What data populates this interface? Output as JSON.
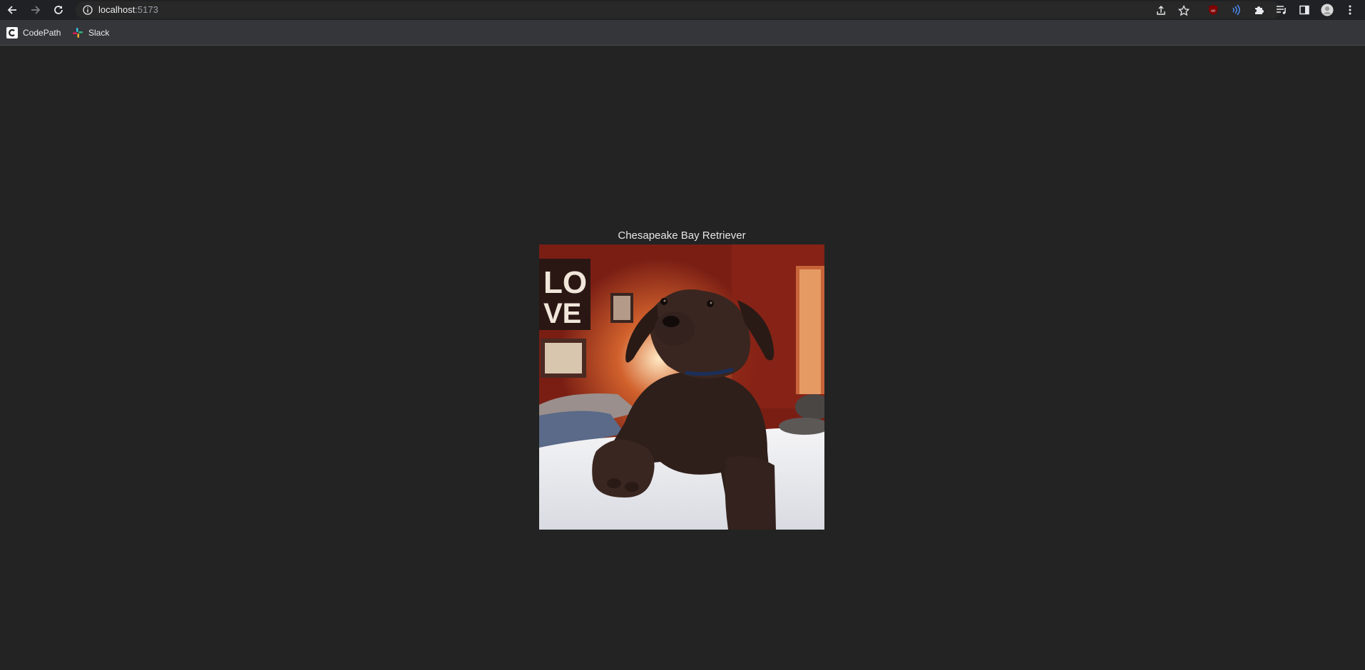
{
  "browser": {
    "url_host": "localhost",
    "url_port": ":5173",
    "bookmarks": [
      {
        "label": "CodePath",
        "icon": "codepath-icon"
      },
      {
        "label": "Slack",
        "icon": "slack-icon"
      }
    ]
  },
  "page": {
    "breed_title": "Chesapeake Bay Retriever",
    "image_alt": "Chesapeake Bay Retriever",
    "photo_text": {
      "sign_top": "LO",
      "sign_bottom": "VE"
    }
  },
  "colors": {
    "background": "#232323",
    "chrome": "#202124",
    "bookmarks_bar": "#35363a"
  }
}
